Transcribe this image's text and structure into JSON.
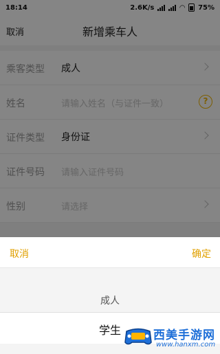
{
  "status_bar": {
    "time": "18:14",
    "net_speed": "2.6K/s",
    "battery": "75%"
  },
  "nav": {
    "cancel": "取消",
    "title": "新增乘车人"
  },
  "form": {
    "passenger_type": {
      "label": "乘客类型",
      "value": "成人"
    },
    "name": {
      "label": "姓名",
      "placeholder": "请输入姓名（与证件一致）"
    },
    "id_type": {
      "label": "证件类型",
      "value": "身份证"
    },
    "id_number": {
      "label": "证件号码",
      "placeholder": "请输入证件号码"
    },
    "gender": {
      "label": "性别",
      "placeholder": "请选择"
    }
  },
  "picker_sheet": {
    "cancel": "取消",
    "confirm": "确定",
    "options": [
      "成人",
      "学生"
    ],
    "selected": "学生"
  },
  "watermark": {
    "title": "西美手游网",
    "url": "www.hanxm.com"
  },
  "colors": {
    "accent": "#e0a000",
    "overlay": "rgba(0,0,0,0.48)",
    "watermark": "#1e6fd8"
  }
}
